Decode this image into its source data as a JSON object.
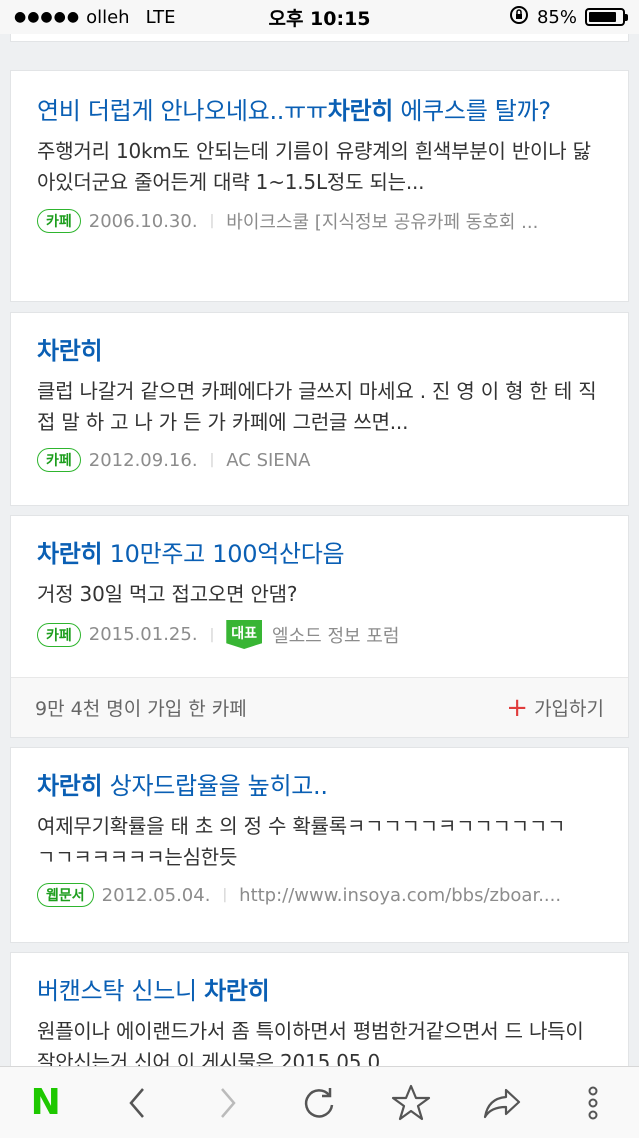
{
  "status": {
    "carrier": "olleh",
    "network": "LTE",
    "time": "오후 10:15",
    "battery": "85%",
    "battery_level": 0.85
  },
  "results": [
    {
      "title_pre": "연비 더럽게 안나오네요..ㅠㅠ",
      "title_bold": "차란히",
      "title_post": " 에쿠스를 탈까?",
      "snippet": "주행거리 10km도 안되는데 기름이 유량계의 흰색부분이 반이나 닳아있더군요 줄어든게 대략 1~1.5L정도 되는...",
      "badge": "카페",
      "date": "2006.10.30.",
      "source": "바이크스쿨 [지식정보 공유카페 동호회 ..."
    },
    {
      "title_bold": "차란히",
      "snippet": "클럽 나갈거 같으면 카페에다가 글쓰지 마세요 . 진 영 이 형 한 테 직 접 말 하 고 나 가 든 가 카페에 그런글 쓰면...",
      "badge": "카페",
      "date": "2012.09.16.",
      "source": "AC SIENA"
    },
    {
      "title_bold": "차란히",
      "title_post": " 10만주고 100억산다음",
      "snippet": "거정 30일 먹고 접고오면 안댐?",
      "badge": "카페",
      "date": "2015.01.25.",
      "rep_badge": "대표",
      "source": "엘소드 정보 포럼",
      "cafe_members": "9만 4천 명이 가입 한 카페",
      "join_label": "가입하기"
    },
    {
      "title_bold": "차란히",
      "title_post": " 상자드랍율을 높히고..",
      "snippet": "여제무기확률을 태 초 의 정 수 확률록ㅋㄱㄱㄱㄱㅋㄱㄱㄱㄱㄱㄱㄱㄱㅋㅋㅋㅋㅋ는심한듯",
      "badge": "웹문서",
      "date": "2012.05.04.",
      "source": "http://www.insoya.com/bbs/zboar...."
    },
    {
      "title_pre": "버캔스탁 신느니 ",
      "title_bold": "차란히",
      "snippet": "원플이나 에이랜드가서 좀 특이하면서 평범한거같으면서 드 나득이 잘안신는거 신어 이 게시물은 2015.05.0"
    }
  ],
  "toolbar": {
    "logo": "N",
    "icons": [
      "naver-home-icon",
      "back-icon",
      "forward-icon",
      "reload-icon",
      "bookmark-star-icon",
      "share-icon",
      "more-icon"
    ]
  }
}
